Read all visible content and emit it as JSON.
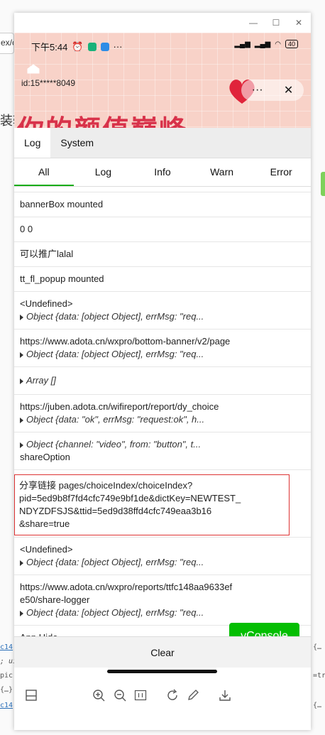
{
  "background": {
    "url_fragment": "ex/c",
    "heading_fragment": "装输",
    "code_lines": [
      "c14",
      "; ui",
      "pic",
      "{…}",
      "c14"
    ],
    "code_right": [
      "{…",
      "=tr",
      "{…"
    ]
  },
  "window": {
    "minimize_label": "—",
    "maximize_label": "☐",
    "close_label": "✕"
  },
  "device_status": {
    "time": "下午5:44",
    "more": "···",
    "battery": "40"
  },
  "mini_program": {
    "user_id": "id:15*****8049",
    "menu_more": "···",
    "menu_close": "✕",
    "banner_text": "你的颜值巅峰"
  },
  "vconsole": {
    "main_tabs": [
      "Log",
      "System"
    ],
    "log_tabs": [
      "All",
      "Log",
      "Info",
      "Warn",
      "Error"
    ],
    "entries": [
      {
        "line1": "bannerBox mounted"
      },
      {
        "line1": "0 0"
      },
      {
        "line1": "可以推广lalal"
      },
      {
        "line1": "tt_fl_popup mounted"
      },
      {
        "line1": "<Undefined>",
        "detail": "Object {data: [object Object], errMsg: \"req..."
      },
      {
        "line1": "https://www.adota.cn/wxpro/bottom-banner/v2/page",
        "detail": "Object {data: [object Object], errMsg: \"req..."
      },
      {
        "detail": "Array []"
      },
      {
        "line1": "https://juben.adota.cn/wifireport/report/dy_choice",
        "detail": "Object {data: \"ok\", errMsg: \"request:ok\", h..."
      },
      {
        "detail": "Object {channel: \"video\", from: \"button\", t...",
        "line2": "shareOption"
      },
      {
        "share": true,
        "lines": [
          "分享链接 pages/choiceIndex/choiceIndex?",
          "pid=5ed9b8f7fd4cfc749e9bf1de&dictKey=NEWTEST_",
          "NDYZDFSJS&ttid=5ed9d38ffd4cfc749eaa3b16",
          "&share=true"
        ]
      },
      {
        "line1": "<Undefined>",
        "detail": "Object {data: [object Object], errMsg: \"req..."
      },
      {
        "lines": [
          "https://www.adota.cn/wxpro/reports/ttfc148aa9633ef",
          "e50/share-logger"
        ],
        "detail": "Object {data: [object Object], errMsg: \"req..."
      },
      {
        "line1": "App Hide"
      }
    ],
    "vconsole_button": "vConsole",
    "clear_label": "Clear"
  }
}
